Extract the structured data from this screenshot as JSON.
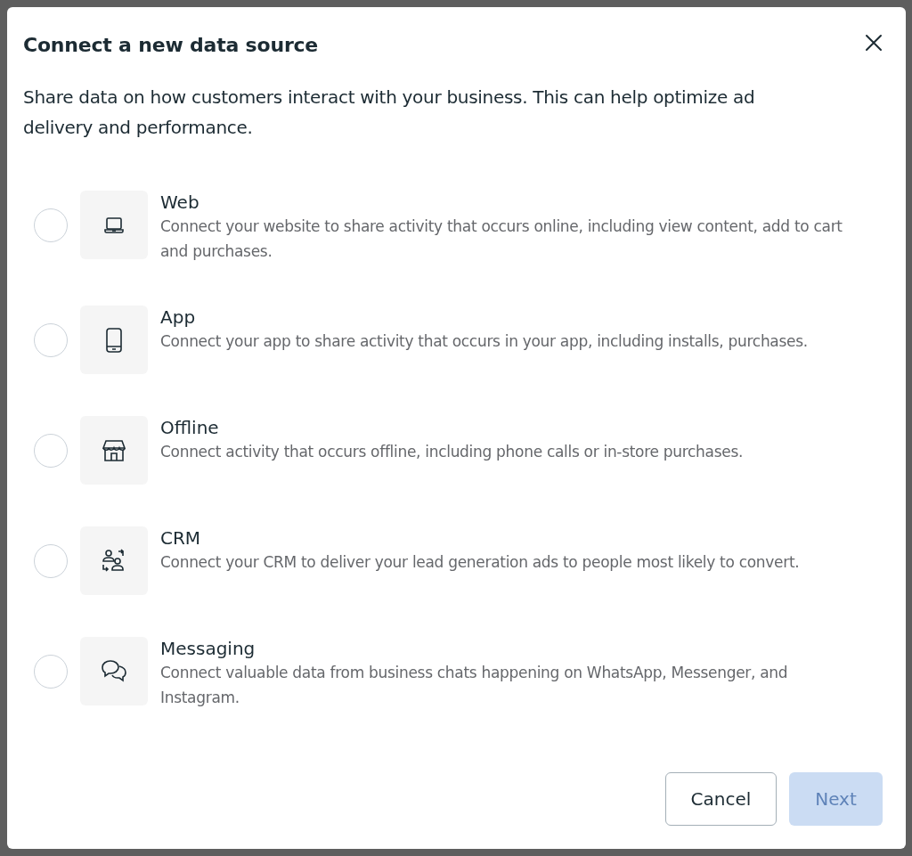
{
  "dialog": {
    "title": "Connect a new data source",
    "description": "Share data on how customers interact with your business. This can help optimize ad delivery and performance."
  },
  "options": [
    {
      "kind": "web",
      "title": "Web",
      "description": "Connect your website to share activity that occurs online, including view content, add to cart and purchases.",
      "selected": false
    },
    {
      "kind": "app",
      "title": "App",
      "description": "Connect your app to share activity that occurs in your app, including installs, purchases.",
      "selected": false
    },
    {
      "kind": "offline",
      "title": "Offline",
      "description": "Connect activity that occurs offline, including phone calls or in-store purchases.",
      "selected": false
    },
    {
      "kind": "crm",
      "title": "CRM",
      "description": "Connect your CRM to deliver your lead generation ads to people most likely to convert.",
      "selected": false
    },
    {
      "kind": "messaging",
      "title": "Messaging",
      "description": "Connect valuable data from business chats happening on WhatsApp, Messenger, and Instagram.",
      "selected": false
    }
  ],
  "buttons": {
    "cancel": {
      "label": "Cancel"
    },
    "next": {
      "label": "Next",
      "disabled": true
    }
  }
}
